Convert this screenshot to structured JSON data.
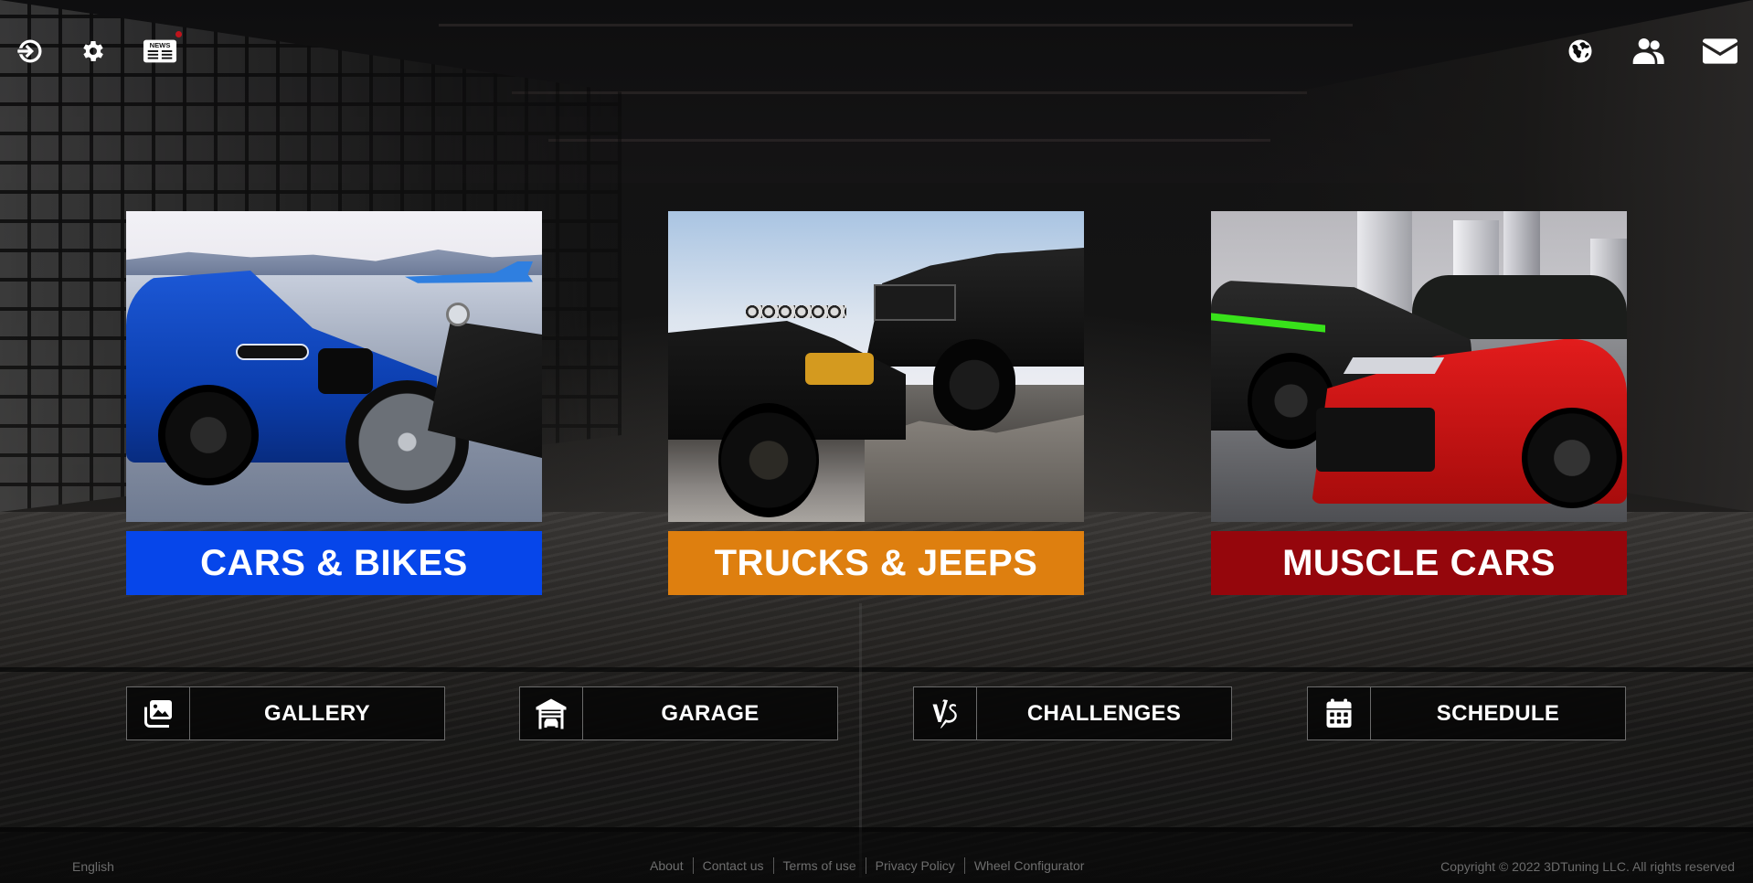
{
  "topbar": {
    "left_icons": [
      {
        "name": "login-icon",
        "label": "Log in"
      },
      {
        "name": "gear-icon",
        "label": "Settings"
      },
      {
        "name": "news-icon",
        "label": "NEWS",
        "has_notification": true
      }
    ],
    "right_icons": [
      {
        "name": "globe-icon",
        "label": "Language"
      },
      {
        "name": "users-icon",
        "label": "Community"
      },
      {
        "name": "mail-icon",
        "label": "Messages"
      }
    ],
    "news_badge_text": "NEWS"
  },
  "categories": [
    {
      "label": "CARS & BIKES",
      "color": "#0646EA",
      "scene": "blue sports car and motorcycle on airport runway"
    },
    {
      "label": "TRUCKS & JEEPS",
      "color": "#DE7F0F",
      "scene": "black jeep and pickup truck on rocks"
    },
    {
      "label": "MUSCLE CARS",
      "color": "#95060C",
      "scene": "black and red muscle cars in city at night"
    }
  ],
  "nav_buttons": [
    {
      "label": "GALLERY",
      "icon": "gallery-icon"
    },
    {
      "label": "GARAGE",
      "icon": "garage-icon"
    },
    {
      "label": "CHALLENGES",
      "icon": "versus-icon"
    },
    {
      "label": "SCHEDULE",
      "icon": "calendar-icon"
    }
  ],
  "footer": {
    "language": "English",
    "links": [
      "About",
      "Contact us",
      "Terms of use",
      "Privacy Policy",
      "Wheel Configurator"
    ],
    "copyright": "Copyright © 2022 3DTuning LLC. All rights reserved"
  }
}
